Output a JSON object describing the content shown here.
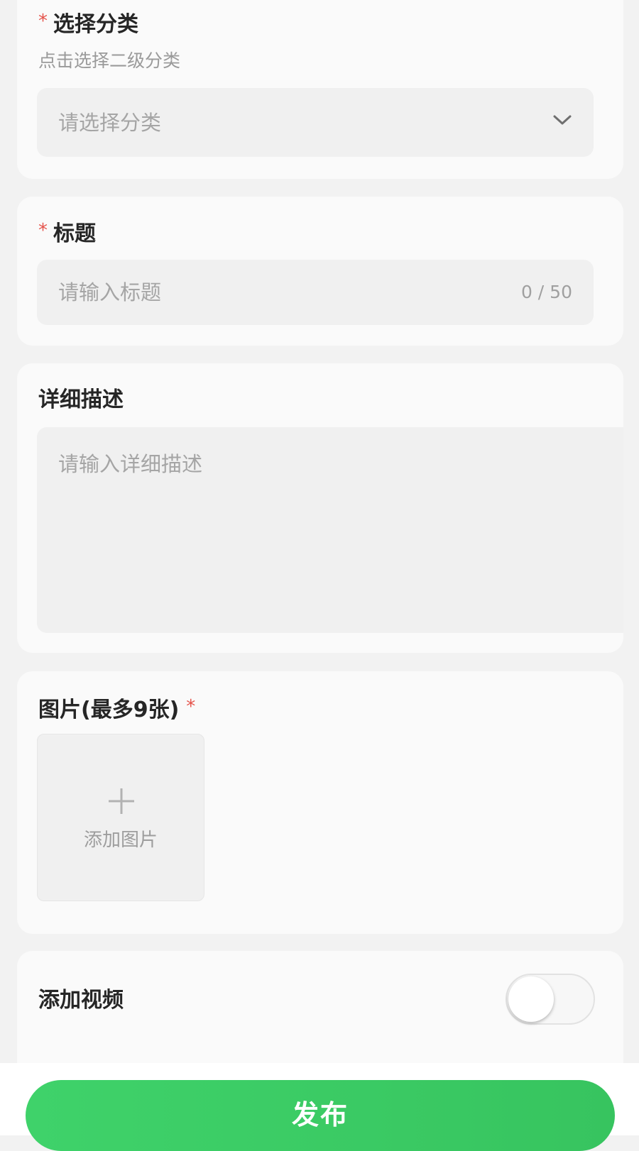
{
  "category": {
    "required_mark": "*",
    "label": "选择分类",
    "hint": "点击选择二级分类",
    "placeholder": "请选择分类"
  },
  "title": {
    "required_mark": "*",
    "label": "标题",
    "placeholder": "请输入标题",
    "counter": "0 / 50"
  },
  "description": {
    "label": "详细描述",
    "placeholder": "请输入详细描述"
  },
  "images": {
    "label": "图片(最多9张)",
    "required_mark": "*",
    "add_icon": "plus-icon",
    "add_label": "添加图片"
  },
  "video": {
    "label": "添加视频",
    "toggle_on": false
  },
  "footer": {
    "publish_label": "发布"
  },
  "colors": {
    "accent": "#3fd26a",
    "required": "#e5534b",
    "background": "#f2f2f2",
    "card": "#fafafa",
    "field": "#f0f0f0"
  }
}
